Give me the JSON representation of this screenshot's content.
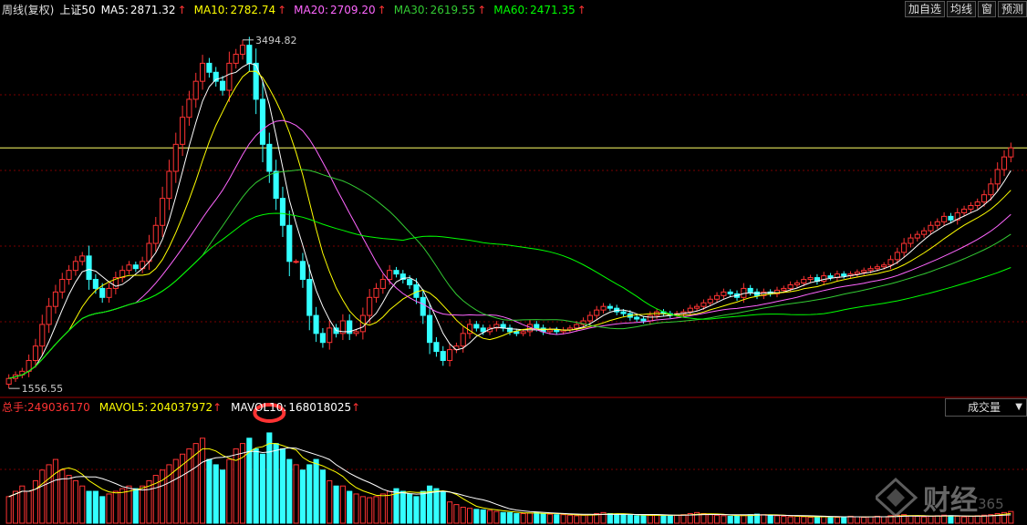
{
  "header": {
    "title": "周线(复权)",
    "index_name": "上证50",
    "ma": [
      {
        "label": "MA5:",
        "value": "2871.32",
        "color": "#ffffff"
      },
      {
        "label": "MA10:",
        "value": "2782.74",
        "color": "#ffff00"
      },
      {
        "label": "MA20:",
        "value": "2709.20",
        "color": "#ff66ff"
      },
      {
        "label": "MA30:",
        "value": "2619.55",
        "color": "#33cc33"
      },
      {
        "label": "MA60:",
        "value": "2471.35",
        "color": "#00ff00"
      }
    ],
    "arrow": "↑",
    "arrow_color": "#ff3333"
  },
  "toolbar": {
    "add_label": "加自选",
    "avg_label": "均线",
    "window_label": "窗",
    "forecast_label": "预测"
  },
  "volume_header": {
    "total": {
      "label": "总手:",
      "value": "249036170",
      "color": "#ff3333"
    },
    "mavol5": {
      "label": "MAVOL5:",
      "value": "204037972",
      "color": "#ffff00"
    },
    "mavol10": {
      "label": "MAVOL10:",
      "value": "168018025",
      "color": "#ffffff"
    }
  },
  "indicator_selector": "成交量",
  "logo_text": "财经",
  "logo_sub": "365",
  "colors": {
    "up": "#ff3333",
    "down": "#33ffff",
    "grid": "#7a0000",
    "ref_line": "#ffff66",
    "highlight": "#ff3333"
  },
  "chart_data": {
    "type": "candlestick",
    "price_ylim": [
      1500,
      3600
    ],
    "ref_level": 2880,
    "annotations": [
      {
        "text": "3494.82",
        "bar_index": 35
      },
      {
        "text": "1556.55",
        "bar_index": 0
      }
    ],
    "highlight_volume_bar": 39,
    "close": [
      1600,
      1620,
      1640,
      1700,
      1780,
      1900,
      2000,
      2080,
      2150,
      2200,
      2250,
      2280,
      2150,
      2100,
      2050,
      2100,
      2160,
      2200,
      2230,
      2210,
      2250,
      2350,
      2450,
      2600,
      2750,
      2900,
      3050,
      3150,
      3250,
      3350,
      3300,
      3250,
      3200,
      3350,
      3400,
      3450,
      3350,
      3150,
      2900,
      2750,
      2600,
      2450,
      2250,
      2250,
      2150,
      1950,
      1850,
      1800,
      1880,
      1850,
      1920,
      1850,
      1860,
      1950,
      2050,
      2100,
      2150,
      2200,
      2180,
      2150,
      2120,
      2050,
      1950,
      1800,
      1750,
      1700,
      1760,
      1780,
      1850,
      1900,
      1880,
      1860,
      1880,
      1900,
      1880,
      1860,
      1850,
      1860,
      1900,
      1880,
      1860,
      1870,
      1860,
      1870,
      1880,
      1900,
      1920,
      1950,
      1980,
      2000,
      1990,
      1970,
      1960,
      1940,
      1930,
      1920,
      1950,
      1970,
      1960,
      1950,
      1960,
      1970,
      1990,
      2000,
      2020,
      2040,
      2060,
      2080,
      2070,
      2050,
      2100,
      2080,
      2060,
      2080,
      2070,
      2090,
      2100,
      2120,
      2130,
      2150,
      2160,
      2140,
      2170,
      2160,
      2180,
      2170,
      2180,
      2190,
      2200,
      2210,
      2220,
      2230,
      2260,
      2300,
      2350,
      2380,
      2400,
      2420,
      2450,
      2470,
      2500,
      2480,
      2520,
      2540,
      2560,
      2580,
      2620,
      2680,
      2760,
      2830,
      2880
    ],
    "volume": [
      50,
      60,
      70,
      60,
      80,
      100,
      110,
      120,
      100,
      90,
      80,
      70,
      60,
      60,
      50,
      55,
      60,
      65,
      70,
      65,
      70,
      80,
      90,
      100,
      110,
      120,
      130,
      140,
      150,
      160,
      120,
      110,
      100,
      120,
      140,
      150,
      160,
      140,
      130,
      170,
      150,
      140,
      120,
      110,
      100,
      110,
      120,
      100,
      80,
      70,
      70,
      60,
      55,
      50,
      48,
      50,
      55,
      60,
      65,
      60,
      55,
      50,
      60,
      70,
      65,
      60,
      40,
      35,
      30,
      28,
      26,
      25,
      24,
      22,
      20,
      20,
      18,
      18,
      19,
      20,
      18,
      17,
      16,
      16,
      15,
      14,
      15,
      16,
      18,
      20,
      18,
      17,
      16,
      15,
      14,
      14,
      15,
      16,
      15,
      14,
      15,
      16,
      18,
      20,
      18,
      16,
      15,
      14,
      13,
      14,
      15,
      16,
      17,
      16,
      15,
      14,
      13,
      12,
      13,
      12,
      11,
      12,
      13,
      12,
      11,
      12,
      13,
      12,
      11,
      12,
      13,
      12,
      14,
      15,
      16,
      14,
      13,
      12,
      13,
      14,
      15,
      14,
      13,
      12,
      13,
      14,
      15,
      16,
      18,
      20,
      22
    ]
  }
}
